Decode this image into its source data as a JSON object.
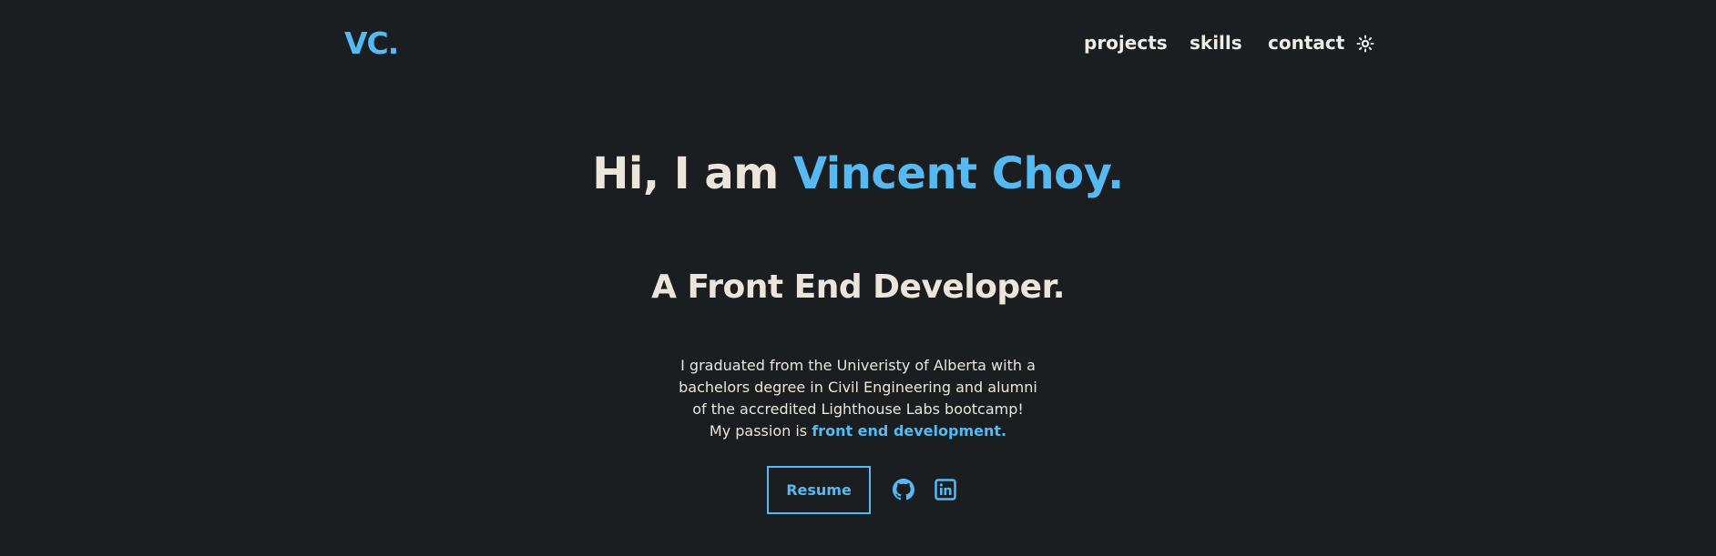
{
  "header": {
    "logo": "VC.",
    "nav": {
      "projects": "projects",
      "skills": "skills",
      "contact": "contact"
    },
    "theme_toggle_icon": "sun-icon"
  },
  "hero": {
    "greeting": "Hi, I am ",
    "name": "Vincent Choy.",
    "subtitle": "A Front End Developer.",
    "bio": {
      "line1": "I graduated from the Univeristy of Alberta with a",
      "line2": "bachelors degree in Civil Engineering and alumni",
      "line3": "of the accredited Lighthouse Labs bootcamp!",
      "line4_prefix": "My passion is ",
      "highlight": "front end development."
    },
    "resume_label": "Resume",
    "social_icons": [
      "github-icon",
      "linkedin-icon"
    ]
  },
  "colors": {
    "background": "#1b1e20",
    "accent": "#56b9f2",
    "text": "#ece5da"
  }
}
